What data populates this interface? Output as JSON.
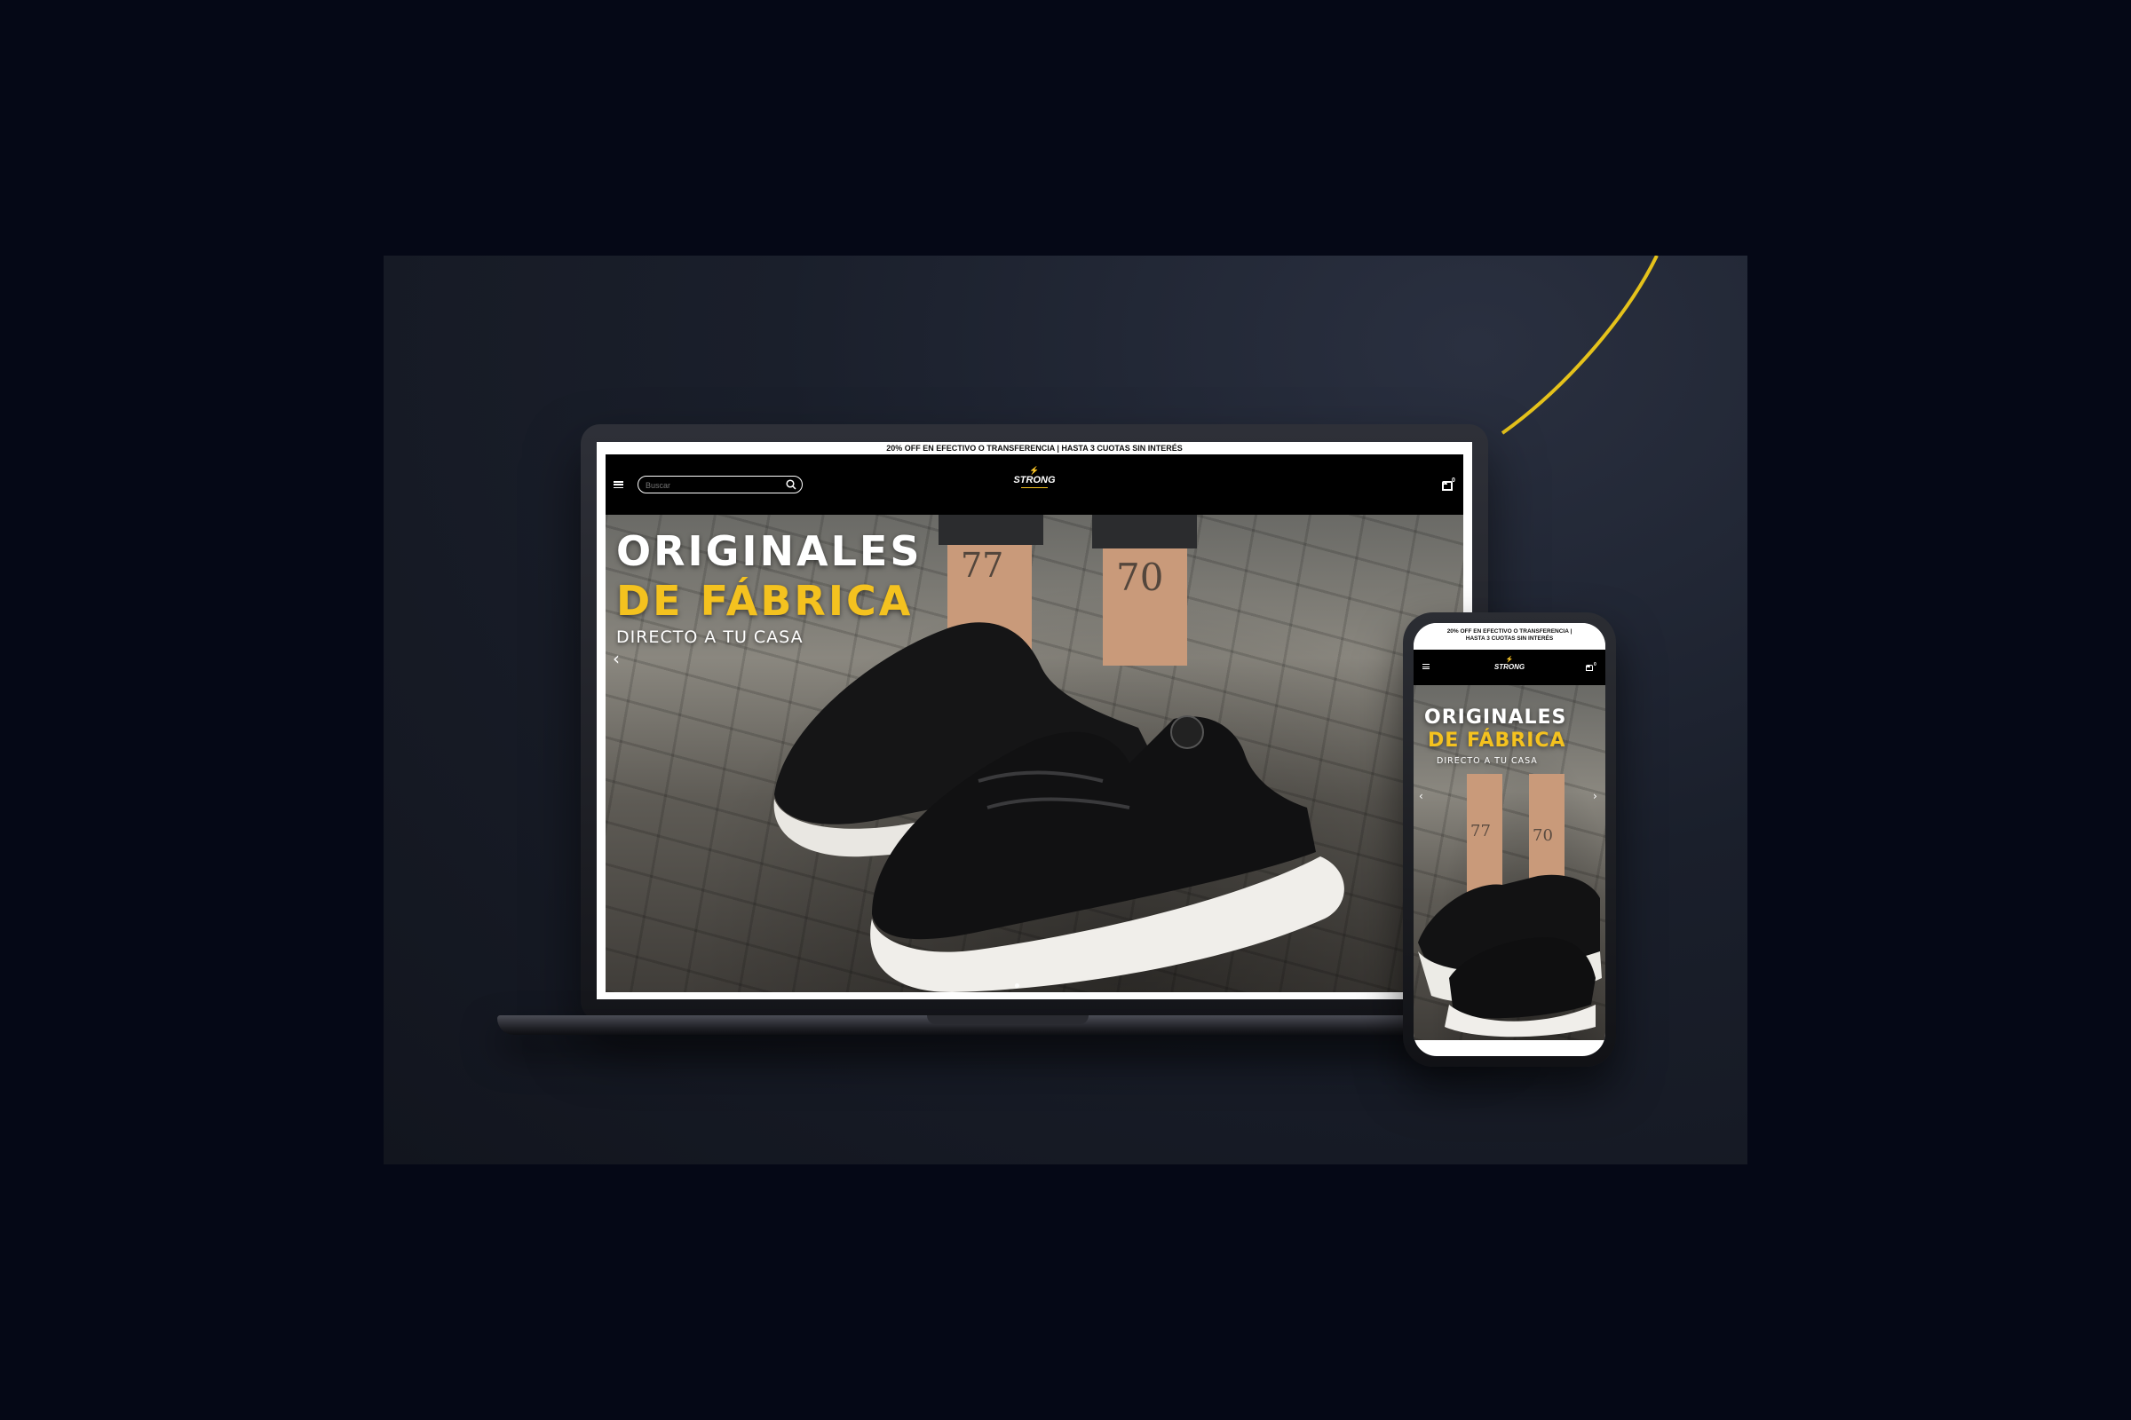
{
  "promo": {
    "laptop_text": "20% OFF EN EFECTIVO O TRANSFERENCIA | HASTA 3 CUOTAS SIN INTERÉS",
    "phone_line1": "20% OFF EN EFECTIVO O TRANSFERENCIA |",
    "phone_line2": "HASTA 3 CUOTAS SIN INTERÉS"
  },
  "header": {
    "search_placeholder": "Buscar",
    "logo_text": "STRONG",
    "cart_count": "0"
  },
  "hero": {
    "title": "ORIGINALES",
    "subtitle": "DE FÁBRICA",
    "tagline": "DIRECTO A TU CASA",
    "prev_arrow": "‹",
    "next_arrow": "›"
  },
  "colors": {
    "accent": "#f4c21f",
    "header_bg": "#000000",
    "page_bg": "#050816"
  }
}
